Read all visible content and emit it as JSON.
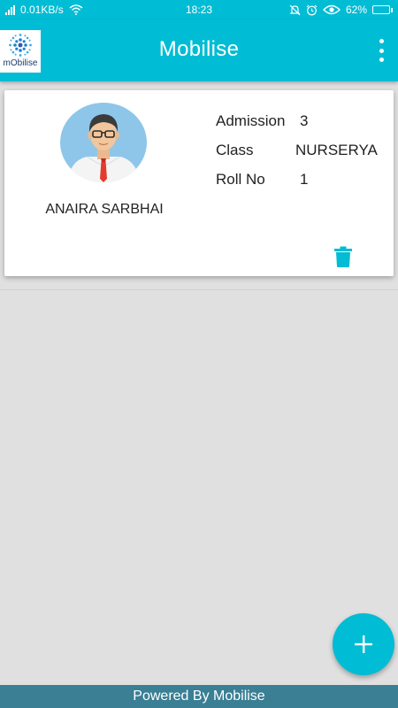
{
  "status_bar": {
    "network_speed": "0.01KB/s",
    "time": "18:23",
    "battery": "62%",
    "battery_level": 0.62,
    "icons": [
      "signal-icon",
      "wifi-icon",
      "notifications-off-icon",
      "alarm-icon",
      "eye-icon",
      "battery-icon"
    ]
  },
  "app_bar": {
    "logo_text": "mObilise",
    "title": "Mobilise",
    "menu_icon": "more-vert-icon"
  },
  "student_card": {
    "name": "ANAIRA SARBHAI",
    "fields": [
      {
        "label": "Admission",
        "value": "3"
      },
      {
        "label": "Class",
        "value": "NURSERYA"
      },
      {
        "label": "Roll No",
        "value": "1"
      }
    ],
    "delete_icon": "trash-icon",
    "avatar_icon": "person-avatar-icon"
  },
  "fab": {
    "icon": "plus-icon"
  },
  "footer": {
    "text": "Powered By Mobilise"
  },
  "colors": {
    "primary": "#00bcd4",
    "footer": "#3a7f94",
    "background": "#e0e0e0",
    "avatar_bg": "#8ec6ea",
    "tie": "#e23b2e"
  }
}
